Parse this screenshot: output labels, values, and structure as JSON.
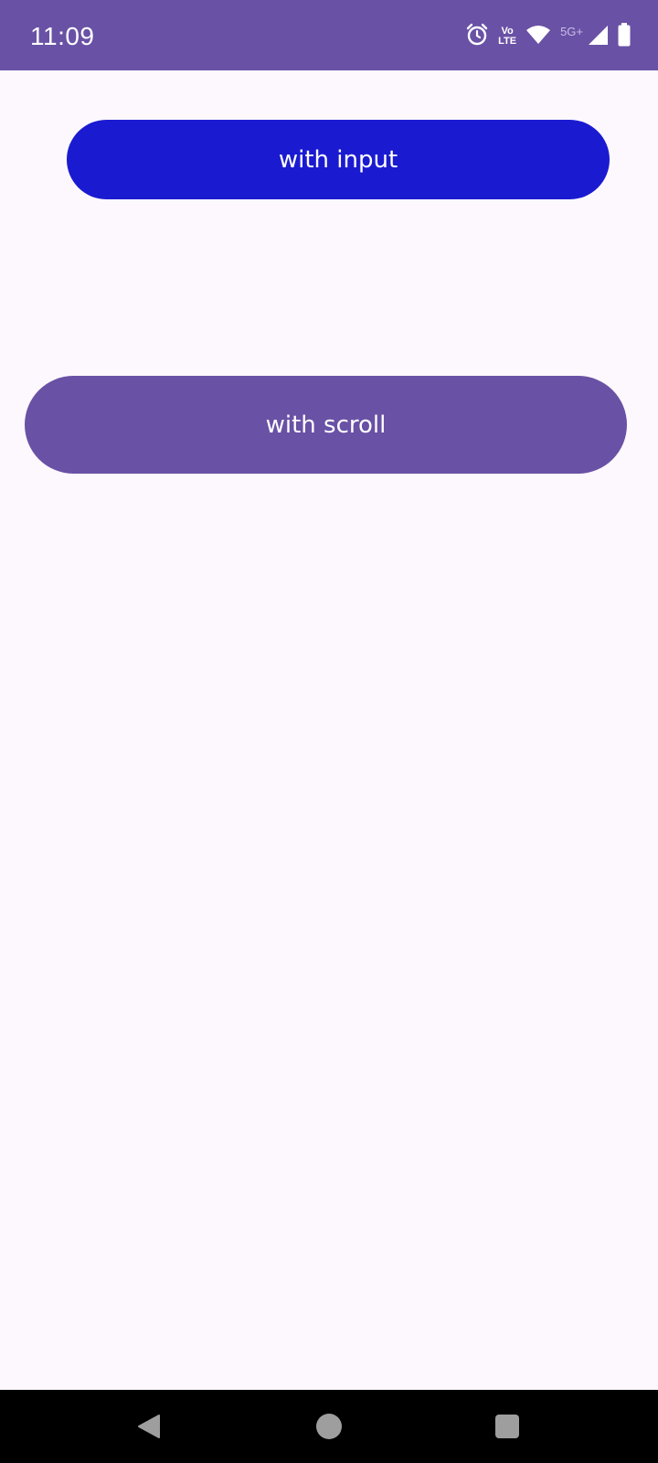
{
  "status_bar": {
    "time": "11:09",
    "network_type": "5G+",
    "volte_top": "Vo",
    "volte_bottom": "LTE",
    "icons": [
      "alarm-icon",
      "volte-icon",
      "wifi-icon",
      "signal-icon",
      "battery-icon"
    ],
    "background_color": "#6951a5"
  },
  "main": {
    "background_color": "#fdf8fd",
    "buttons": [
      {
        "label": "with input",
        "color": "#1a1bd1"
      },
      {
        "label": "with scroll",
        "color": "#6951a5"
      }
    ]
  },
  "nav_bar": {
    "icons": [
      "back-icon",
      "home-icon",
      "recents-icon"
    ]
  }
}
